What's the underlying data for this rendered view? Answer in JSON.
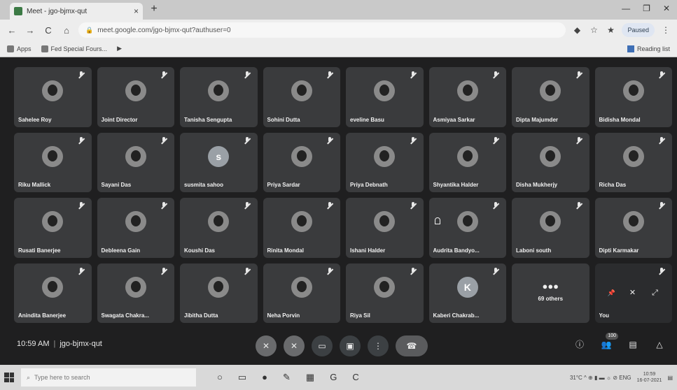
{
  "browser": {
    "tab_title": "Meet - jgo-bjmx-qut",
    "tab_close": "×",
    "new_tab": "+",
    "window_controls": [
      "—",
      "❐",
      "✕"
    ],
    "nav": {
      "back": "←",
      "forward": "→",
      "reload": "C",
      "home": "⌂"
    },
    "url": "meet.google.com/jgo-bjmx-qut?authuser=0",
    "extensions": [
      "◆",
      "☆",
      "★"
    ],
    "profile_label": "Paused",
    "menu": "⋮",
    "bookmarks": [
      {
        "label": "Apps"
      },
      {
        "label": "Fed Special Fours..."
      },
      {
        "label": "▶"
      }
    ],
    "reading_list": "Reading list"
  },
  "meet": {
    "participants": [
      {
        "name": "Sahelee Roy",
        "avatar": "photo"
      },
      {
        "name": "Joint Director",
        "avatar": "photo"
      },
      {
        "name": "Tanisha Sengupta",
        "avatar": "photo"
      },
      {
        "name": "Sohini Dutta",
        "avatar": "photo"
      },
      {
        "name": "eveline Basu",
        "avatar": "photo"
      },
      {
        "name": "Asmiyaa Sarkar",
        "avatar": "photo"
      },
      {
        "name": "Dipta Majumder",
        "avatar": "photo"
      },
      {
        "name": "Bidisha Mondal",
        "avatar": "photo"
      },
      {
        "name": "Riku Mallick",
        "avatar": "photo"
      },
      {
        "name": "Sayani Das",
        "avatar": "photo"
      },
      {
        "name": "susmita sahoo",
        "avatar": "letter",
        "letter": "s"
      },
      {
        "name": "Priya Sardar",
        "avatar": "photo"
      },
      {
        "name": "Priya Debnath",
        "avatar": "photo"
      },
      {
        "name": "Shyantika Halder",
        "avatar": "photo"
      },
      {
        "name": "Disha Mukherjy",
        "avatar": "photo"
      },
      {
        "name": "Richa Das",
        "avatar": "photo"
      },
      {
        "name": "Rusati Banerjee",
        "avatar": "photo"
      },
      {
        "name": "Debleena Gain",
        "avatar": "photo"
      },
      {
        "name": "Koushi Das",
        "avatar": "photo"
      },
      {
        "name": "Rinita Mondal",
        "avatar": "photo"
      },
      {
        "name": "Ishani Halder",
        "avatar": "photo"
      },
      {
        "name": "Audrita Bandyo...",
        "avatar": "photo",
        "pinned": true
      },
      {
        "name": "Laboni south",
        "avatar": "photo"
      },
      {
        "name": "Dipti Karmakar",
        "avatar": "photo"
      },
      {
        "name": "Anindita Banerjee",
        "avatar": "photo"
      },
      {
        "name": "Swagata Chakra...",
        "avatar": "photo"
      },
      {
        "name": "Jibitha Dutta",
        "avatar": "photo"
      },
      {
        "name": "Neha Porvin",
        "avatar": "photo"
      },
      {
        "name": "Riya Sil",
        "avatar": "photo"
      },
      {
        "name": "Kaberi Chakrab...",
        "avatar": "letter",
        "letter": "K"
      }
    ],
    "others_tile": {
      "label": "69 others"
    },
    "self_tile": {
      "label": "You"
    },
    "time": "10:59 AM",
    "separator": "|",
    "meeting_code": "jgo-bjmx-qut",
    "participant_count": "100",
    "controls": {
      "mic": "✕",
      "camera": "✕",
      "captions": "▭",
      "present": "▣",
      "more": "⋮",
      "end_call": "☎"
    },
    "right_controls": {
      "info": "ⓘ",
      "people": "👥",
      "chat": "▤",
      "activities": "△"
    },
    "self_controls": {
      "pin": "📌",
      "mute": "✕",
      "expand": "⤢"
    }
  },
  "taskbar": {
    "search_placeholder": "Type here to search",
    "apps": [
      "○",
      "▭",
      "●",
      "✎",
      "▦",
      "G",
      "C"
    ],
    "tray": "31°C  ^  ⊕  ▮  ▬  ☼  ⊘  ENG",
    "time": "10:59",
    "date": "16-07-2021"
  }
}
